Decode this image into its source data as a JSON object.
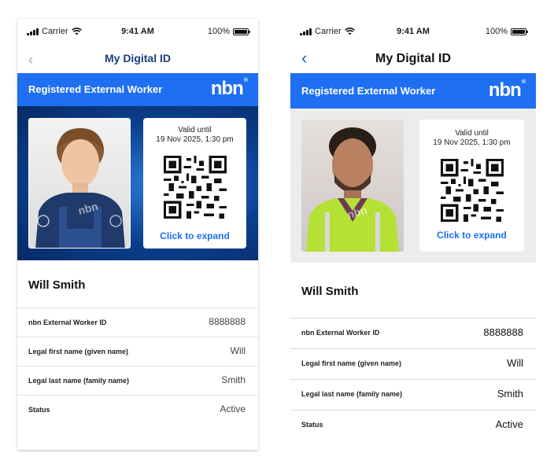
{
  "status_bar": {
    "carrier": "Carrier",
    "time": "9:41 AM",
    "battery": "100%"
  },
  "nav": {
    "back_icon": "chevron-left-icon",
    "title": "My Digital ID"
  },
  "card": {
    "label": "Registered External Worker",
    "logo": "nbn",
    "valid_label": "Valid until",
    "valid_date": "19 Nov 2025, 1:30 pm",
    "expand": "Click to expand",
    "watermark": "nbn"
  },
  "person": {
    "name": "Will Smith"
  },
  "details": [
    {
      "label": "nbn External Worker ID",
      "value": "8888888"
    },
    {
      "label": "Legal first name (given name)",
      "value": "Will"
    },
    {
      "label": "Legal last name (family name)",
      "value": "Smith"
    },
    {
      "label": "Status",
      "value": "Active"
    }
  ],
  "colors": {
    "brand_blue": "#1e6ff1",
    "link_blue": "#1e6ff1",
    "dark_title": "#1c3f7a"
  }
}
